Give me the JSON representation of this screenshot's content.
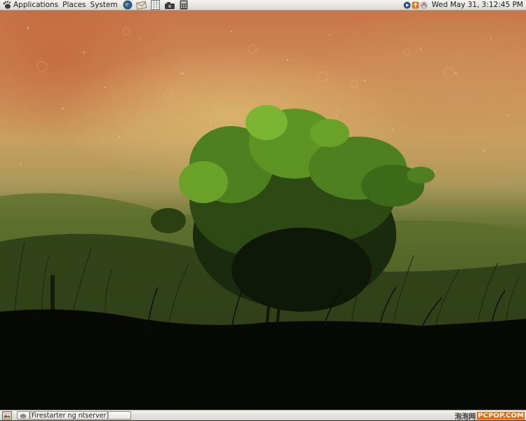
{
  "top_panel": {
    "menus": [
      "Applications",
      "Places",
      "System"
    ],
    "launchers": [
      "web-browser-icon",
      "mail-icon",
      "spreadsheet-icon",
      "camera-icon",
      "calculator-icon"
    ],
    "tray_icons": [
      "media-play-icon",
      "update-icon",
      "network-icon"
    ],
    "clock": "Wed May 31,  3:12:45 PM"
  },
  "bottom_panel": {
    "show_desktop_icon": "show-desktop-icon",
    "tasks": [
      {
        "label": "[Firestarter ng ntserver]",
        "icon": "firestarter-icon"
      }
    ],
    "watermark": {
      "left": "泡泡网",
      "right": "PCPOP.COM"
    }
  },
  "colors": {
    "panel": "#dcdad4",
    "sky_warm": "#c8754a",
    "sky_gold": "#c9a160",
    "grass": "#4b5b26",
    "foliage": "#6aa128"
  }
}
